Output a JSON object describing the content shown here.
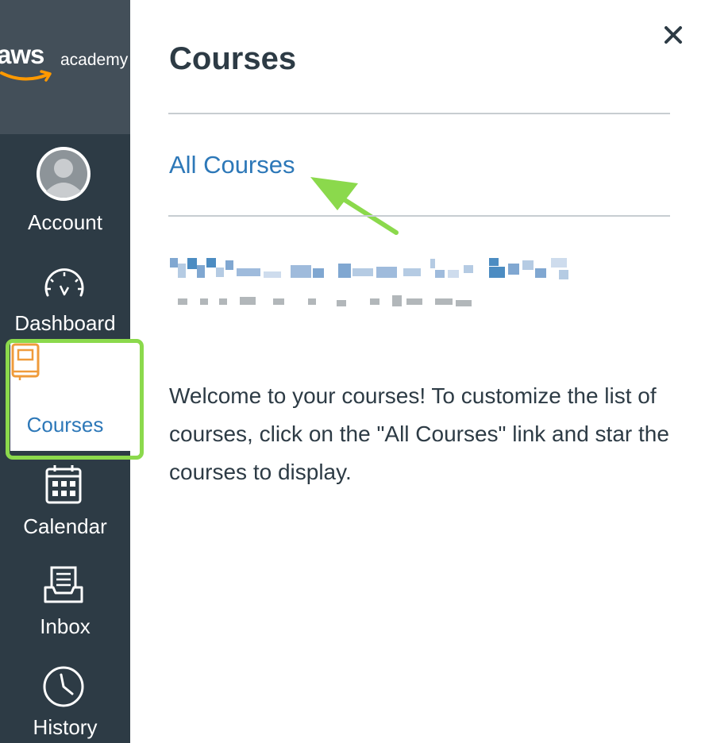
{
  "brand": {
    "logo_text": "aws",
    "logo_sub": "academy",
    "smile_color": "#ff9900"
  },
  "nav": {
    "items": [
      {
        "label": "Account",
        "icon": "avatar-icon"
      },
      {
        "label": "Dashboard",
        "icon": "dashboard-gauge-icon"
      },
      {
        "label": "Courses",
        "icon": "book-icon",
        "active": true
      },
      {
        "label": "Calendar",
        "icon": "calendar-icon"
      },
      {
        "label": "Inbox",
        "icon": "inbox-icon"
      },
      {
        "label": "History",
        "icon": "clock-icon"
      }
    ]
  },
  "tray": {
    "title": "Courses",
    "close_icon": "close-icon",
    "all_courses_label": "All Courses",
    "welcome_text": "Welcome to your courses! To customize the list of courses, click on the \"All Courses\" link and star the courses to display."
  },
  "colors": {
    "nav_bg": "#2d3b45",
    "logo_bg": "#434f59",
    "link": "#2d78b8",
    "active_icon": "#ef9b3b",
    "highlight": "#8bd94c"
  }
}
